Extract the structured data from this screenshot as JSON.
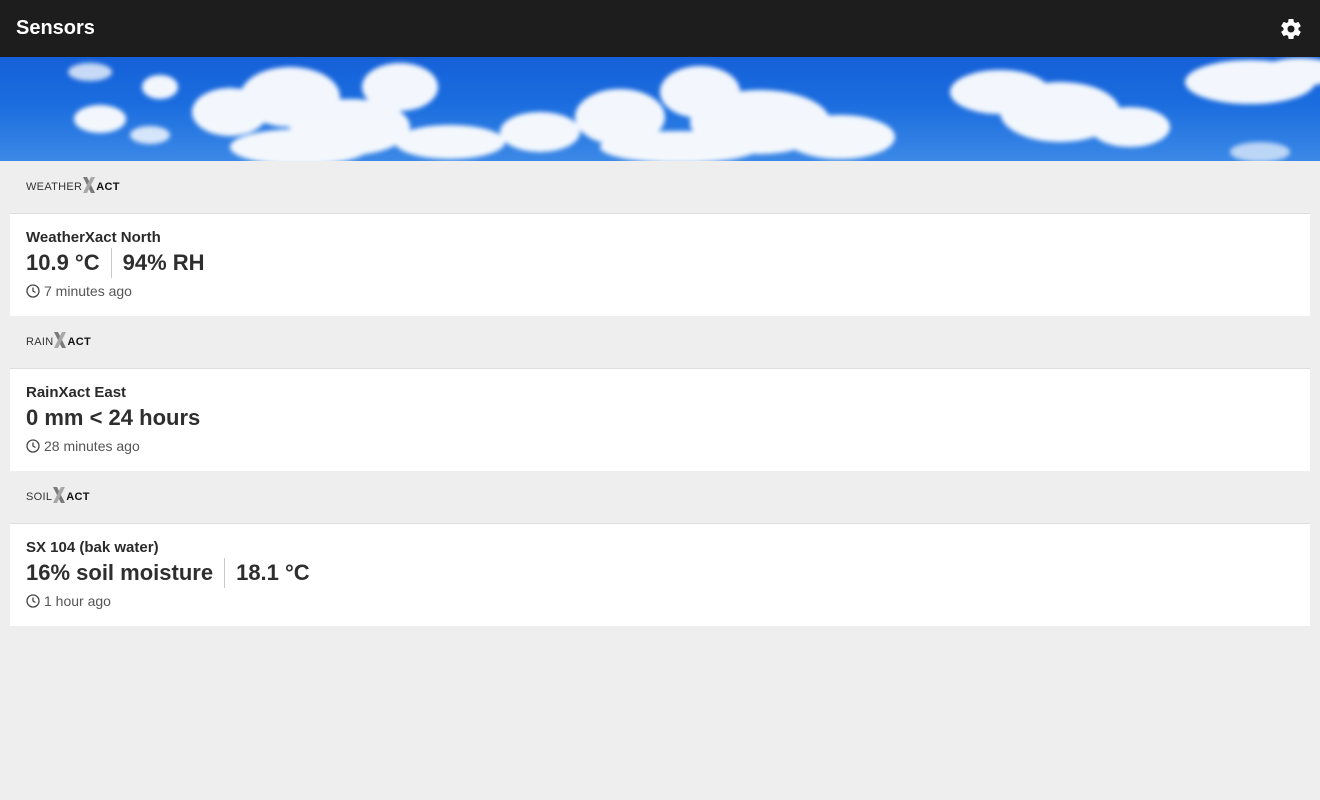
{
  "app_bar": {
    "title": "Sensors",
    "settings_icon": "gear-icon"
  },
  "banner": {
    "description_icon": "sky-clouds-banner"
  },
  "colors": {
    "app_bar": "#1d1d1d",
    "background": "#eeeeee",
    "card": "#ffffff",
    "sky": "#1b6ddf"
  },
  "sections": [
    {
      "brand_prefix": "WEATHER",
      "brand_suffix": "ACT",
      "sensors": [
        {
          "name": "WeatherXact North",
          "value1": "10.9 °C",
          "value2": "94% RH",
          "time": "7 minutes ago"
        }
      ]
    },
    {
      "brand_prefix": "RAIN",
      "brand_suffix": "ACT",
      "sensors": [
        {
          "name": "RainXact East",
          "value1": "0 mm < 24 hours",
          "time": "28 minutes ago"
        }
      ]
    },
    {
      "brand_prefix": "SOIL",
      "brand_suffix": "ACT",
      "sensors": [
        {
          "name": "SX 104 (bak water)",
          "value1": "16% soil moisture",
          "value2": "18.1 °C",
          "time": "1 hour ago"
        }
      ]
    }
  ]
}
